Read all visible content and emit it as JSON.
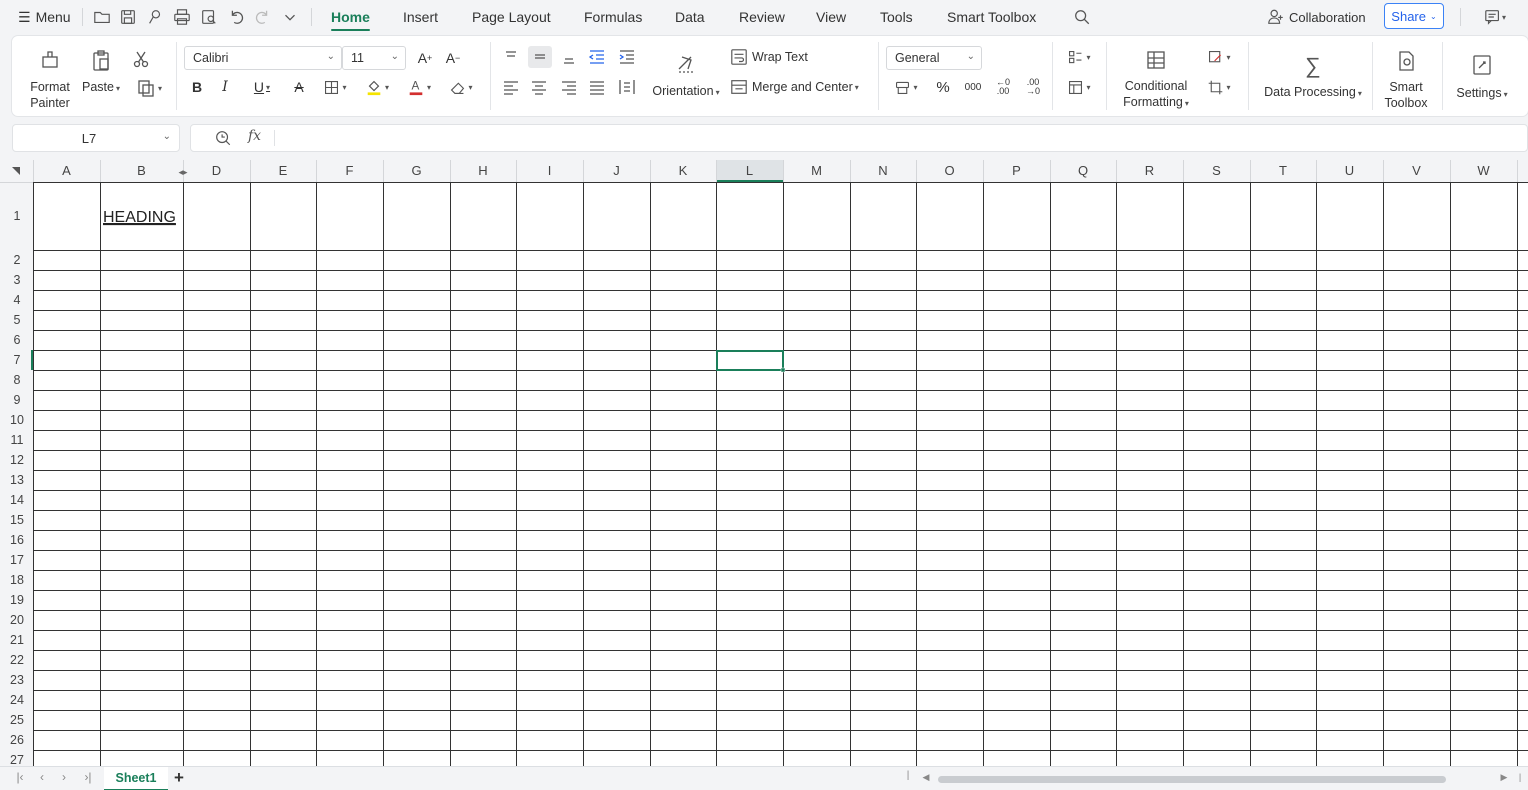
{
  "menubar": {
    "menu_label": "Menu",
    "tabs": [
      "Home",
      "Insert",
      "Page Layout",
      "Formulas",
      "Data",
      "Review",
      "View",
      "Tools",
      "Smart Toolbox"
    ],
    "active_tab": "Home",
    "collaboration_label": "Collaboration",
    "share_label": "Share",
    "accent_color": "#1a7f5a"
  },
  "ribbon": {
    "format_painter_label": "Format Painter",
    "paste_label": "Paste",
    "font_name": "Calibri",
    "font_size": "11",
    "wrap_text_label": "Wrap Text",
    "orientation_label": "Orientation",
    "merge_center_label": "Merge and Center",
    "number_format": "General",
    "conditional_formatting_label": "Conditional Formatting",
    "data_processing_label": "Data Processing",
    "smart_toolbox_label": "Smart Toolbox",
    "settings_label": "Settings"
  },
  "formula_bar": {
    "name_box": "L7",
    "fx_label": "fx",
    "formula": ""
  },
  "sheet": {
    "columns": [
      "A",
      "B",
      "D",
      "E",
      "F",
      "G",
      "H",
      "I",
      "J",
      "K",
      "L",
      "M",
      "N",
      "O",
      "P",
      "Q",
      "R",
      "S",
      "T",
      "U",
      "V",
      "W"
    ],
    "rows": [
      "1",
      "2",
      "3",
      "4",
      "5",
      "6",
      "7",
      "8",
      "9",
      "10",
      "11",
      "12",
      "13",
      "14",
      "15",
      "16",
      "17",
      "18",
      "19",
      "20",
      "21",
      "22",
      "23",
      "24",
      "25",
      "26",
      "27"
    ],
    "selected_cell": "L7",
    "selected_column": "L",
    "selected_row": "7",
    "cells": [
      {
        "ref": "B1",
        "value": "HEADING",
        "underline": true
      }
    ]
  },
  "tabs": {
    "sheets": [
      "Sheet1"
    ],
    "active_sheet": "Sheet1",
    "add_label": "+"
  }
}
